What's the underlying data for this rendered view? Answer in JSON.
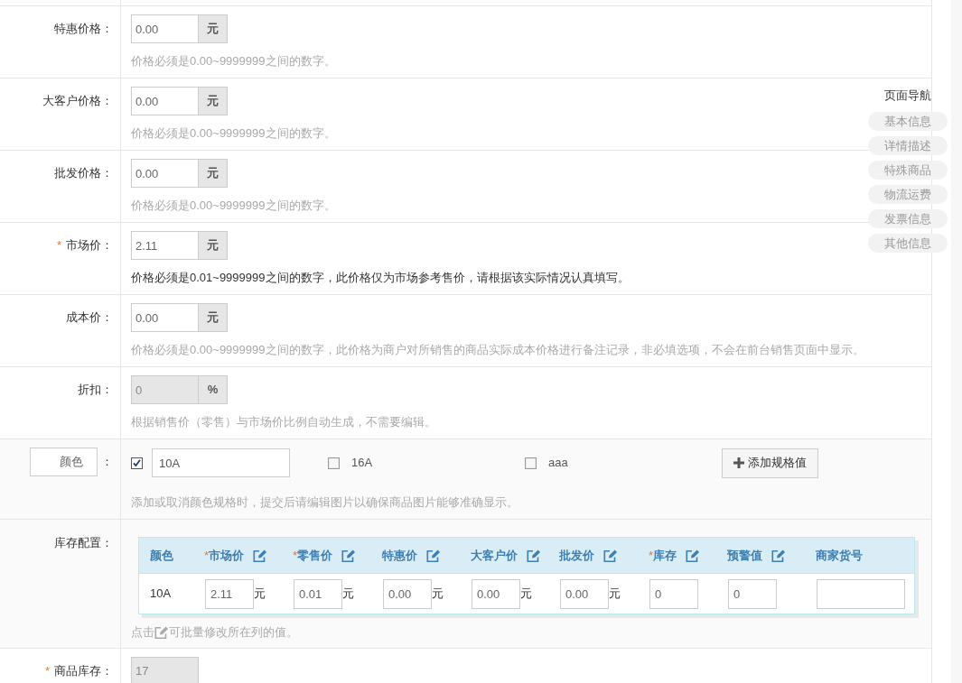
{
  "form_rows": [
    {
      "kind": "price",
      "label": "特惠价格：",
      "value": "0.00",
      "unit": "元",
      "readonly": false,
      "hint": "价格必须是0.00~9999999之间的数字。",
      "hint_emphasis": false
    },
    {
      "kind": "price",
      "label": "大客户价格：",
      "value": "0.00",
      "unit": "元",
      "readonly": false,
      "hint": "价格必须是0.00~9999999之间的数字。",
      "hint_emphasis": false
    },
    {
      "kind": "price",
      "label": "批发价格：",
      "value": "0.00",
      "unit": "元",
      "readonly": false,
      "hint": "价格必须是0.00~9999999之间的数字。",
      "hint_emphasis": false
    },
    {
      "kind": "price",
      "required_mark": "*",
      "label": "市场价：",
      "value": "2.11",
      "unit": "元",
      "readonly": false,
      "hint": "价格必须是0.01~9999999之间的数字，此价格仅为市场参考售价，请根据该实际情况认真填写。",
      "hint_emphasis": true
    },
    {
      "kind": "price",
      "label": "成本价：",
      "value": "0.00",
      "unit": "元",
      "readonly": false,
      "hint": "价格必须是0.00~9999999之间的数字，此价格为商户对所销售的商品实际成本价格进行备注记录，非必填选项，不会在前台销售页面中显示。",
      "hint_emphasis": false
    },
    {
      "kind": "price",
      "label": "折扣：",
      "value": "0",
      "unit": "%",
      "readonly": true,
      "hint": "根据销售价（零售）与市场价比例自动生成，不需要编辑。",
      "hint_emphasis": false
    },
    {
      "kind": "spec",
      "spec_name": "颜色",
      "separator": "：",
      "options": [
        {
          "checked": true,
          "value": "10A"
        },
        {
          "checked": false,
          "value": "16A"
        },
        {
          "checked": false,
          "value": "aaa"
        }
      ],
      "add_button": "添加规格值",
      "hint": "添加或取消颜色规格时，提交后请编辑图片以确保商品图片能够准确显示。"
    },
    {
      "kind": "stock_table",
      "label": "库存配置：",
      "table": {
        "columns": [
          {
            "label": "颜色",
            "batch_edit": false
          },
          {
            "required_mark": "*",
            "label": "市场价",
            "batch_edit": true
          },
          {
            "required_mark": "*",
            "label": "零售价",
            "batch_edit": true
          },
          {
            "label": "特惠价",
            "batch_edit": true
          },
          {
            "label": "大客户价",
            "batch_edit": true
          },
          {
            "label": "批发价",
            "batch_edit": true
          },
          {
            "required_mark": "*",
            "label": "库存",
            "batch_edit": true
          },
          {
            "label": "预警值",
            "batch_edit": true
          },
          {
            "label": "商家货号",
            "batch_edit": false
          }
        ],
        "rows": [
          {
            "cells": [
              {
                "kind": "text",
                "text": "10A"
              },
              {
                "kind": "price",
                "value": "2.11",
                "unit": "元"
              },
              {
                "kind": "price",
                "value": "0.01",
                "unit": "元"
              },
              {
                "kind": "price",
                "value": "0.00",
                "unit": "元"
              },
              {
                "kind": "price",
                "value": "0.00",
                "unit": "元"
              },
              {
                "kind": "price",
                "value": "0.00",
                "unit": "元"
              },
              {
                "kind": "number",
                "value": "0"
              },
              {
                "kind": "number",
                "value": "0"
              },
              {
                "kind": "code"
              }
            ]
          }
        ]
      },
      "hint_before": "点击",
      "hint_after": "可批量修改所在列的值。"
    },
    {
      "kind": "stock_total",
      "required_mark": "*",
      "label": "商品库存：",
      "value": "17",
      "readonly": true
    }
  ],
  "page_nav": {
    "title": "页面导航",
    "items": [
      {
        "label": "基本信息"
      },
      {
        "label": "详情描述"
      },
      {
        "label": "特殊商品"
      },
      {
        "label": "物流运费"
      },
      {
        "label": "发票信息"
      },
      {
        "label": "其他信息"
      }
    ]
  }
}
